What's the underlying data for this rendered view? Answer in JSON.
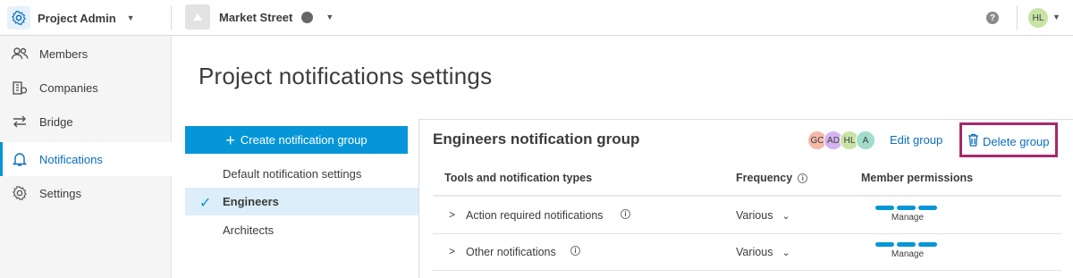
{
  "header": {
    "app_title": "Project Admin",
    "project_name": "Market Street",
    "help_label": "?",
    "user_initials": "HL"
  },
  "sidebar": {
    "items": [
      {
        "label": "Members",
        "icon": "members-icon"
      },
      {
        "label": "Companies",
        "icon": "companies-icon"
      },
      {
        "label": "Bridge",
        "icon": "bridge-icon"
      },
      {
        "label": "Notifications",
        "icon": "bell-icon",
        "active": true
      },
      {
        "label": "Settings",
        "icon": "gear-icon"
      }
    ]
  },
  "page": {
    "title": "Project notifications settings"
  },
  "groups": {
    "create_label": "Create notification group",
    "items": [
      {
        "label": "Default notification settings"
      },
      {
        "label": "Engineers",
        "selected": true
      },
      {
        "label": "Architects"
      }
    ]
  },
  "detail": {
    "title": "Engineers notification group",
    "members": [
      {
        "initials": "GC",
        "color": "#f4b9a7"
      },
      {
        "initials": "AD",
        "color": "#d5b3ef"
      },
      {
        "initials": "HL",
        "color": "#c7e3a5"
      },
      {
        "initials": "A",
        "color": "#9fdccb"
      }
    ],
    "edit_label": "Edit group",
    "delete_label": "Delete group",
    "table": {
      "headers": {
        "types": "Tools and notification types",
        "frequency": "Frequency",
        "permissions": "Member permissions"
      },
      "rows": [
        {
          "label": "Action required notifications",
          "frequency": "Various",
          "permission": "Manage"
        },
        {
          "label": "Other notifications",
          "frequency": "Various",
          "permission": "Manage"
        }
      ]
    }
  },
  "colors": {
    "accent": "#0696d7",
    "link": "#0a6ebd",
    "highlight_box": "#a7286d",
    "selected_bg": "#dceefa"
  }
}
